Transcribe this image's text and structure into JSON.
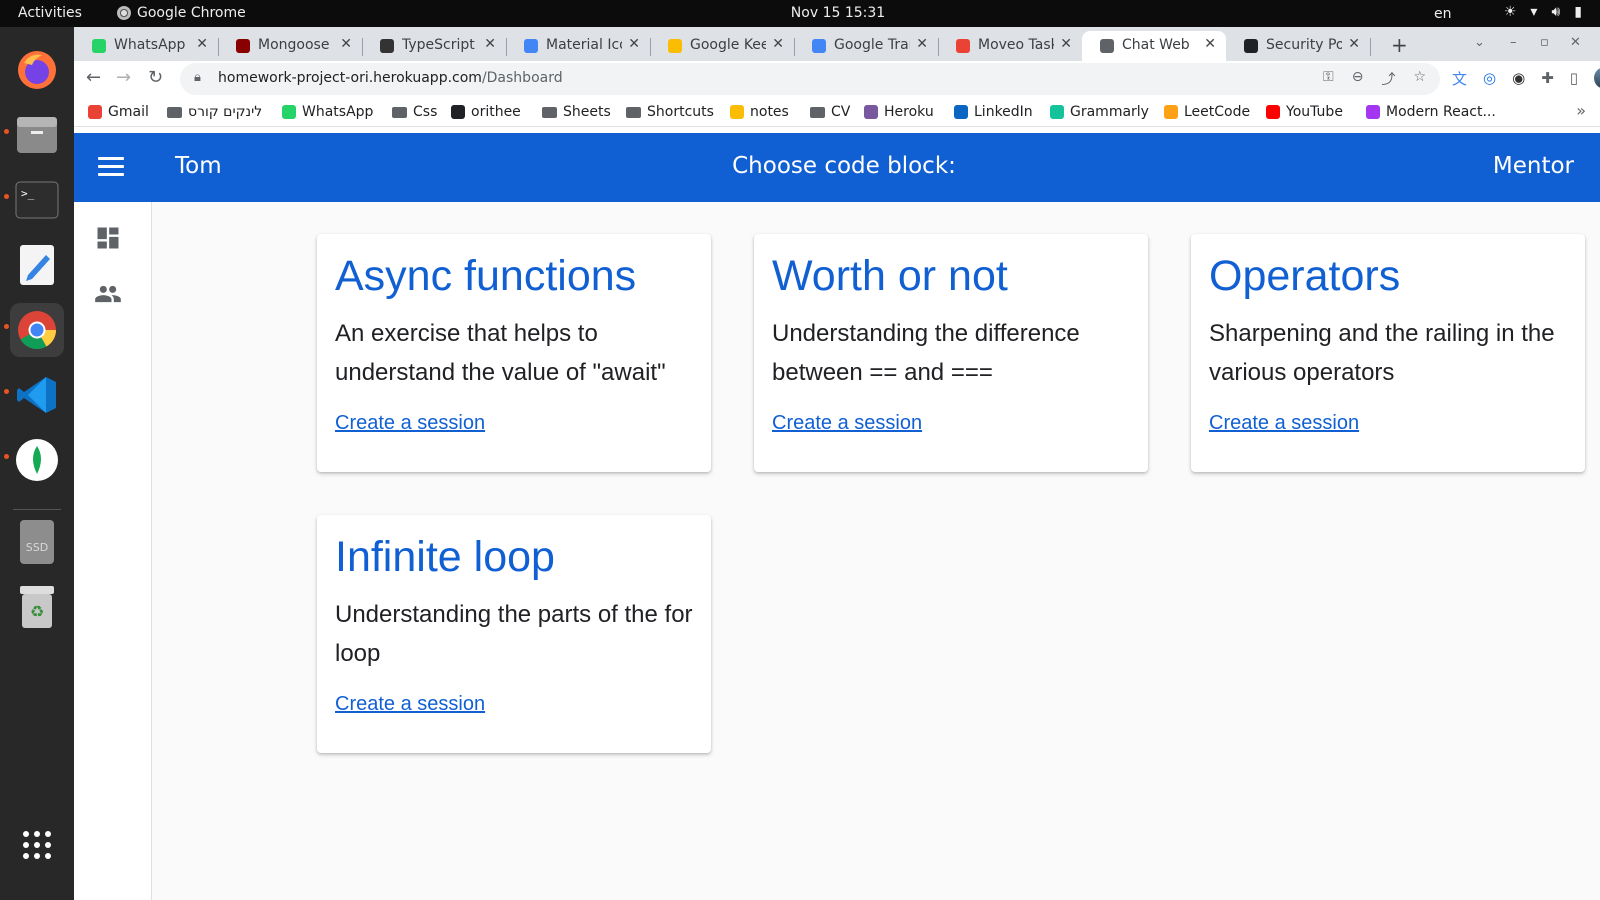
{
  "system": {
    "activities": "Activities",
    "app_name": "Google Chrome",
    "clock": "Nov 15  15:31",
    "lang": "en"
  },
  "dock": {
    "items": [
      "Firefox",
      "Files",
      "Terminal",
      "Text Editor",
      "Google Chrome",
      "Visual Studio Code",
      "MongoDB Compass",
      "SSD",
      "Trash",
      "Show Applications"
    ],
    "ssd_label": "SSD"
  },
  "browser": {
    "tabs": [
      {
        "title": "WhatsApp",
        "icon": "whatsapp-icon",
        "color": "#25d366"
      },
      {
        "title": "Mongoose v",
        "icon": "mongoose-icon",
        "color": "#880000"
      },
      {
        "title": "TypeScript |",
        "icon": "compass-icon",
        "color": "#333333"
      },
      {
        "title": "Material Ico",
        "icon": "material-icon",
        "color": "#4285f4"
      },
      {
        "title": "Google Kee",
        "icon": "keep-icon",
        "color": "#fbbc04"
      },
      {
        "title": "Google Tran",
        "icon": "translate-icon",
        "color": "#4285f4"
      },
      {
        "title": "Moveo Task",
        "icon": "gmail-icon",
        "color": "#ea4335"
      },
      {
        "title": "Chat Web",
        "icon": "chat-icon",
        "color": "#5f6368"
      },
      {
        "title": "Security Pol",
        "icon": "github-icon",
        "color": "#202124"
      }
    ],
    "url_host": "homework-project-ori.herokuapp.com",
    "url_path": "/Dashboard",
    "bookmarks": [
      {
        "label": "Gmail",
        "kind": "icon",
        "color": "#ea4335"
      },
      {
        "label": "לינקים קורס",
        "kind": "folder"
      },
      {
        "label": "WhatsApp",
        "kind": "icon",
        "color": "#25d366"
      },
      {
        "label": "Css",
        "kind": "folder"
      },
      {
        "label": "orithee",
        "kind": "icon",
        "color": "#202124"
      },
      {
        "label": "Sheets",
        "kind": "folder"
      },
      {
        "label": "Shortcuts",
        "kind": "folder"
      },
      {
        "label": "notes",
        "kind": "icon",
        "color": "#fbbc04"
      },
      {
        "label": "CV",
        "kind": "folder"
      },
      {
        "label": "Heroku",
        "kind": "icon",
        "color": "#79589f"
      },
      {
        "label": "LinkedIn",
        "kind": "icon",
        "color": "#0a66c2"
      },
      {
        "label": "Grammarly",
        "kind": "icon",
        "color": "#15c39a"
      },
      {
        "label": "LeetCode",
        "kind": "icon",
        "color": "#ffa116"
      },
      {
        "label": "YouTube",
        "kind": "icon",
        "color": "#ff0000"
      },
      {
        "label": "Modern React...",
        "kind": "icon",
        "color": "#a435f0"
      }
    ]
  },
  "app": {
    "user": "Tom",
    "title": "Choose code block:",
    "role": "Mentor",
    "accent": "#1160d3",
    "cards": [
      {
        "title": "Async functions",
        "description": "An exercise that helps to understand the value of \"await\"",
        "link": "Create a session"
      },
      {
        "title": "Worth or not",
        "description": "Understanding the difference between == and ===",
        "link": "Create a session"
      },
      {
        "title": "Operators",
        "description": "Sharpening and the railing in the various operators",
        "link": "Create a session"
      },
      {
        "title": "Infinite loop",
        "description": "Understanding the parts of the for loop",
        "link": "Create a session"
      }
    ]
  }
}
